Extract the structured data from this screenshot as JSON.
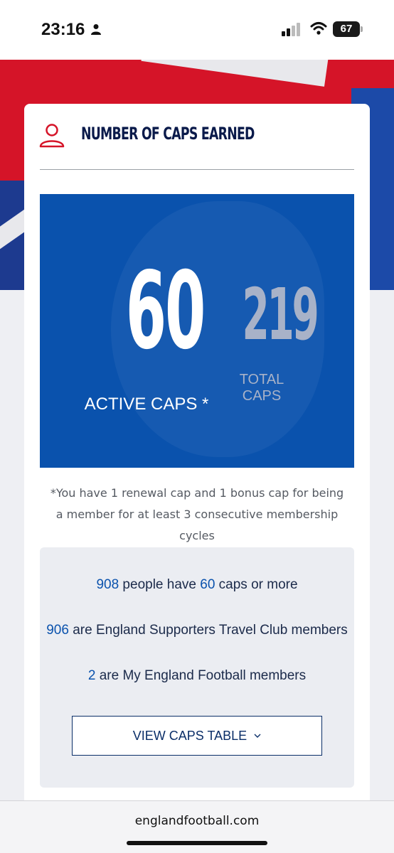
{
  "status_bar": {
    "time": "23:16",
    "battery": "67"
  },
  "card": {
    "title": "NUMBER OF CAPS EARNED",
    "active_caps": {
      "value": "60",
      "label": "ACTIVE CAPS *"
    },
    "total_caps": {
      "value": "219",
      "label": "TOTAL CAPS"
    },
    "footnote": "*You have 1 renewal cap and 1 bonus cap for being a member for at least 3 consecutive membership cycles",
    "stats": [
      {
        "count": "908",
        "pre": "",
        "text": " people have ",
        "caps": "60",
        "post": " caps or more"
      },
      {
        "count": "906",
        "text": " are England Supporters Travel Club members"
      },
      {
        "count": "2",
        "text": " are My England Football members"
      }
    ],
    "view_button": "VIEW CAPS TABLE"
  },
  "browser": {
    "url": "englandfootball.com"
  },
  "colors": {
    "primary_blue": "#0a52ad",
    "navy": "#0a1a4a",
    "accent_red": "#d51428"
  }
}
